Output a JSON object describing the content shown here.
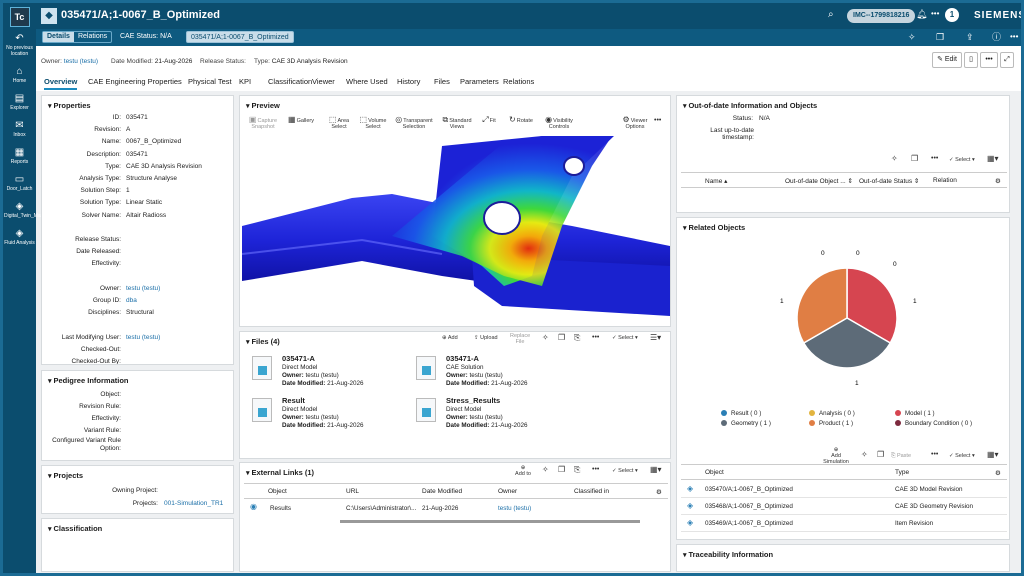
{
  "leftnav": {
    "logo": "Tc",
    "items": [
      {
        "icon": "↶",
        "label": "No previous location"
      },
      {
        "icon": "⌂",
        "label": "Home"
      },
      {
        "icon": "▤",
        "label": "Explorer"
      },
      {
        "icon": "✉",
        "label": "Inbox"
      },
      {
        "icon": "▦",
        "label": "Reports"
      },
      {
        "icon": "▭",
        "label": "Door_Latch"
      },
      {
        "icon": "◈",
        "label": "Digital_Twin_Master_Ass..."
      },
      {
        "icon": "◈",
        "label": "Fluid Analysis"
      }
    ]
  },
  "topbar": {
    "title": "035471/A;1-0067_B_Optimized",
    "pill": "IMC--1799818216",
    "avatar": "1",
    "brand": "SIEMENS",
    "icons": {
      "search": "⌕",
      "bell": "♫",
      "more": "•••"
    }
  },
  "subbar": {
    "tabs": [
      "Details",
      "Relations"
    ],
    "cae_status": "CAE Status: N/A",
    "tag": "035471/A;1-0067_B_Optimized"
  },
  "infobar": {
    "owner_label": "Owner:",
    "owner": "testu (testu)",
    "modified_label": "Date Modified:",
    "modified": "21-Aug-2026",
    "release_label": "Release Status:",
    "release": "",
    "type_label": "Type:",
    "type": "CAE 3D Analysis Revision",
    "edit": "Edit"
  },
  "tabs": [
    "Overview",
    "CAE Engineering Properties",
    "Physical Test",
    "KPI",
    "Classification",
    "Viewer",
    "Where Used",
    "History",
    "Files",
    "Parameters",
    "Relations"
  ],
  "properties": {
    "title": "Properties",
    "rows": [
      [
        "ID:",
        "035471"
      ],
      [
        "Revision:",
        "A"
      ],
      [
        "Name:",
        "0067_B_Optimized"
      ],
      [
        "Description:",
        "035471"
      ],
      [
        "Type:",
        "CAE 3D Analysis Revision"
      ],
      [
        "Analysis Type:",
        "Structure Analyse"
      ],
      [
        "Solution Step:",
        "1"
      ],
      [
        "Solution Type:",
        "Linear Static"
      ],
      [
        "Solver Name:",
        "Altair Radioss"
      ],
      [
        "",
        ""
      ],
      [
        "Release Status:",
        ""
      ],
      [
        "Date Released:",
        ""
      ],
      [
        "Effectivity:",
        ""
      ],
      [
        "",
        ""
      ],
      [
        "Owner:",
        "testu (testu)"
      ],
      [
        "Group ID:",
        "dba"
      ],
      [
        "Disciplines:",
        "Structural"
      ],
      [
        "",
        ""
      ],
      [
        "Last Modifying User:",
        "testu (testu)"
      ],
      [
        "Checked-Out:",
        ""
      ],
      [
        "Checked-Out By:",
        ""
      ]
    ]
  },
  "pedigree": {
    "title": "Pedigree Information",
    "rows": [
      "Object:",
      "Revision Rule:",
      "Effectivity:",
      "Variant Rule:",
      "Configured Variant Rule Option:"
    ]
  },
  "projects": {
    "title": "Projects",
    "owning": "Owning Project:",
    "projects_label": "Projects:",
    "projects": "001-Simulation_TR1"
  },
  "classification": {
    "title": "Classification"
  },
  "preview": {
    "title": "Preview",
    "tools": [
      "Capture Snapshot",
      "Gallery",
      "Area Select",
      "Volume Select",
      "Transparent Selection",
      "Standard Views",
      "Fit",
      "Rotate",
      "Visibility Controls",
      "Viewer Options"
    ]
  },
  "files": {
    "title": "Files (4)",
    "add": "Add",
    "upload": "Upload",
    "replace": "Replace File",
    "select": "Select",
    "items": [
      {
        "name": "035471-A",
        "type": "Direct Model",
        "owner": "testu (testu)",
        "date": "21-Aug-2026"
      },
      {
        "name": "035471-A",
        "type": "CAE Solution",
        "owner": "testu (testu)",
        "date": "21-Aug-2026"
      },
      {
        "name": "Result",
        "type": "Direct Model",
        "owner": "testu (testu)",
        "date": "21-Aug-2026"
      },
      {
        "name": "Stress_Results",
        "type": "Direct Model",
        "owner": "testu (testu)",
        "date": "21-Aug-2026"
      }
    ],
    "owner_label": "Owner:",
    "date_label": "Date Modified:"
  },
  "external": {
    "title": "External Links (1)",
    "add": "Add to",
    "select": "Select",
    "columns": [
      "Object",
      "URL",
      "Date Modified",
      "Owner",
      "Classified in"
    ],
    "row": [
      "Results",
      "C:\\Users\\Administrator\\...",
      "21-Aug-2026",
      "testu (testu)",
      ""
    ]
  },
  "outofdate": {
    "title": "Out-of-date Information and Objects",
    "status_label": "Status:",
    "status": "N/A",
    "lastup_label": "Last up-to-date timestamp:",
    "select": "Select",
    "columns": [
      "Name",
      "Out-of-date Object ...",
      "Out-of-date Status",
      "Relation"
    ]
  },
  "related": {
    "title": "Related Objects",
    "add": "Add Simulation",
    "paste": "Paste",
    "select": "Select",
    "columns": [
      "Object",
      "Type"
    ],
    "rows": [
      [
        "035470/A;1-0067_B_Optimized",
        "CAE 3D Model Revision"
      ],
      [
        "035468/A;1-0067_B_Optimized",
        "CAE 3D Geometry Revision"
      ],
      [
        "035469/A;1-0067_B_Optimized",
        "Item Revision"
      ]
    ]
  },
  "traceability": {
    "title": "Traceability Information"
  },
  "chart_data": {
    "type": "pie",
    "categories": [
      "Result",
      "Analysis",
      "Model",
      "Geometry",
      "Product",
      "Boundary Condition"
    ],
    "values": [
      0,
      0,
      1,
      1,
      1,
      0
    ],
    "colors": [
      "#2a7fb5",
      "#e2b43f",
      "#d64550",
      "#5d6b78",
      "#e07e44",
      "#7d2a3e"
    ],
    "labels": [
      "Result ( 0 )",
      "Analysis ( 0 )",
      "Model ( 1 )",
      "Geometry ( 1 )",
      "Product ( 1 )",
      "Boundary Condition ( 0 )"
    ],
    "slice_labels": [
      "0",
      "0",
      "0",
      "1",
      "1",
      "1"
    ],
    "legend": "bottom"
  }
}
